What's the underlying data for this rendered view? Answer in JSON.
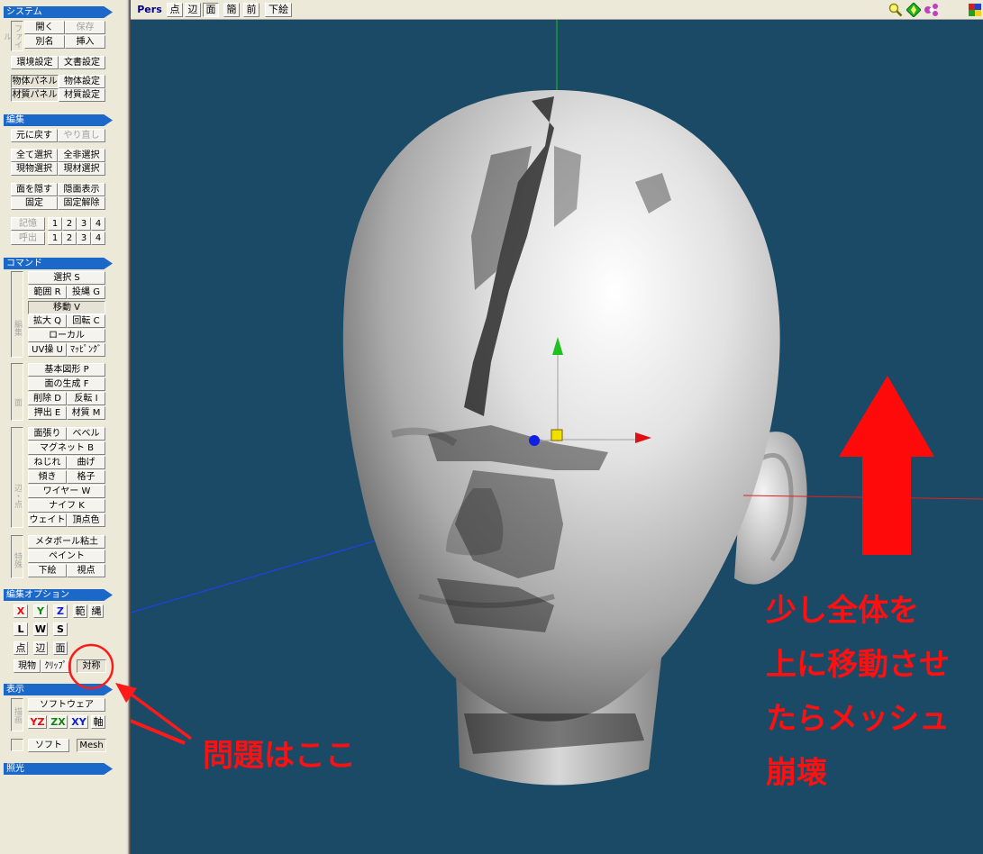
{
  "system": {
    "title": "システム",
    "file_label": "ファイル",
    "open": "開く",
    "save": "保存",
    "rename": "別名",
    "insert": "挿入",
    "env_settings": "環境設定",
    "doc_settings": "文書設定",
    "object_panel": "物体パネル",
    "object_settings": "物体設定",
    "material_panel": "材質パネル",
    "material_settings": "材質設定"
  },
  "edit": {
    "title": "編集",
    "undo": "元に戻す",
    "redo": "やり直し",
    "select_all": "全て選択",
    "deselect_all": "全非選択",
    "select_current_object": "現物選択",
    "select_current_material": "現材選択",
    "hide_faces": "面を隠す",
    "show_hidden": "隠面表示",
    "lock": "固定",
    "unlock": "固定解除",
    "memory": "記憶",
    "recall": "呼出",
    "slots": [
      "1",
      "2",
      "3",
      "4"
    ]
  },
  "command": {
    "title": "コマンド",
    "group_edit": "編集",
    "group_face": "面",
    "group_edge_vertex": "辺・点",
    "group_special": "特殊",
    "select": "選択 S",
    "range": "範囲 R",
    "lasso": "投縄 G",
    "move": "移動 V",
    "scale": "拡大 Q",
    "rotate": "回転 C",
    "local": "ローカル",
    "uv": "UV操 U",
    "mapping": "ﾏｯﾋﾟﾝｸﾞ",
    "primitive": "基本図形 P",
    "generate_face": "面の生成 F",
    "delete": "削除 D",
    "flip": "反転 I",
    "extrude": "押出 E",
    "material": "材質 M",
    "stretch_face": "面張り",
    "bevel": "ベベル",
    "magnet": "マグネット B",
    "twist": "ねじれ",
    "bend": "曲げ",
    "tilt": "傾き",
    "lattice": "格子",
    "wire": "ワイヤー W",
    "knife": "ナイフ K",
    "weight": "ウェイト",
    "vertex_color": "頂点色",
    "metaball": "メタボール粘土",
    "paint": "ペイント",
    "underlay": "下絵",
    "viewpoint": "視点"
  },
  "edit_options": {
    "title": "編集オプション",
    "x": "X",
    "y": "Y",
    "z": "Z",
    "range": "範",
    "lasso": "縄",
    "l": "L",
    "w": "W",
    "s": "S",
    "vertex": "点",
    "edge": "辺",
    "face": "面",
    "current_object": "現物",
    "clip": "ｸﾘｯﾌﾟ",
    "symmetry": "対称"
  },
  "display": {
    "title": "表示",
    "render_label": "描画",
    "software_ware": "ソフトウェア",
    "yz": "YZ",
    "zx": "ZX",
    "xy": "XY",
    "axis": "軸",
    "soft": "ソフト",
    "mesh": "Mesh"
  },
  "lighting": {
    "title": "照光"
  },
  "toolbar": {
    "pers": "Pers",
    "vertex": "点",
    "edge": "辺",
    "face": "面",
    "simple": "簡",
    "front": "前",
    "underlay": "下絵"
  },
  "annotations": {
    "problem_here": "問題はここ",
    "note_lines": [
      "少し全体を",
      "上に移動させ",
      "たらメッシュ",
      "崩壊"
    ]
  },
  "colors": {
    "viewport_bg": "#1a4a66",
    "panel_header": "#1c68c8",
    "annotation_red": "#ff1010"
  }
}
